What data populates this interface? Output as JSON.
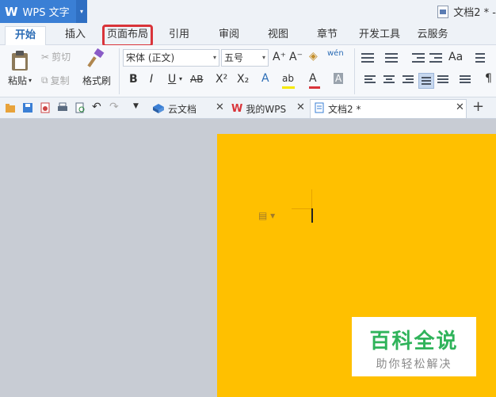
{
  "app": {
    "logo": "W",
    "name": "WPS 文字",
    "menu_arrow": "▾"
  },
  "window": {
    "doc_title": "文档2 * -"
  },
  "menu": {
    "tabs": [
      "开始",
      "插入",
      "页面布局",
      "引用",
      "审阅",
      "视图",
      "章节",
      "开发工具",
      "云服务"
    ],
    "active": "开始",
    "highlighted": "页面布局"
  },
  "ribbon": {
    "paste_label": "粘贴",
    "cut_label": "剪切",
    "copy_label": "复制",
    "format_painter_label": "格式刷",
    "font_name": "宋体 (正文)",
    "font_size": "五号",
    "grow_font": "A⁺",
    "shrink_font": "A⁻",
    "bold": "B",
    "italic": "I",
    "underline": "U",
    "strike": "AB",
    "superscript": "X²",
    "subscript": "X₂",
    "text_effect": "A",
    "highlight": "ab",
    "font_color": "A",
    "char_shading": "A",
    "phonetic": "wén",
    "change_case": "Aa",
    "colors": {
      "font_color_bar": "#d9343a",
      "highlight_bar": "#f5e800",
      "accent": "#2b6cb5"
    }
  },
  "quickbar": {
    "doc_tabs": [
      {
        "label": "云文档",
        "icon": "cloud-doc-icon"
      },
      {
        "label": "我的WPS",
        "icon": "wps-logo-icon"
      },
      {
        "label": "文档2 *",
        "icon": "writer-doc-icon"
      }
    ],
    "new_tab": "+"
  },
  "watermark": {
    "title": "百科全说",
    "subtitle": "助你轻松解决"
  }
}
